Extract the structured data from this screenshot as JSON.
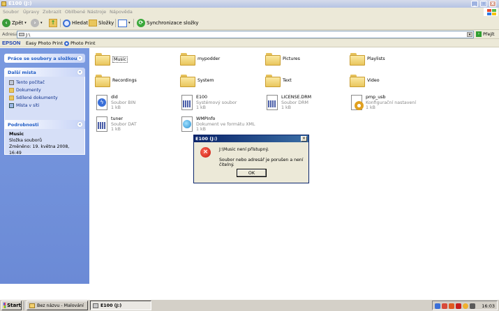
{
  "window": {
    "title": "E100 (J:)",
    "colors": {
      "title_inactive": "#b5c3e3",
      "panel": "#6b8ad6",
      "link": "#0c2f8a"
    }
  },
  "menu": [
    "Soubor",
    "Úpravy",
    "Zobrazit",
    "Oblíbené",
    "Nástroje",
    "Nápověda"
  ],
  "toolbar": {
    "back": "Zpět",
    "search": "Hledat",
    "folders": "Složky",
    "sync": "Synchronizace složky"
  },
  "address": {
    "label": "Adresa",
    "value": "J:\\",
    "go": "Přejít"
  },
  "epson": {
    "brand": "EPSON",
    "easy_photo_print": "Easy Photo Print",
    "photo_print": "Photo Print"
  },
  "left": {
    "tasks_title": "Práce se soubory a složkou",
    "places_title": "Další místa",
    "places": [
      "Tento počítač",
      "Dokumenty",
      "Sdílené dokumenty",
      "Místa v síti"
    ],
    "details_title": "Podrobnosti",
    "details_name": "Music",
    "details_type": "Složka souborů",
    "details_modified": "Změněno: 19. května 2008, 16:49"
  },
  "folders": [
    "Music",
    "mypodder",
    "Pictures",
    "Playlists",
    "Recordings",
    "System",
    "Text",
    "Video"
  ],
  "files": [
    {
      "name": "did",
      "type": "Soubor BIN",
      "size": "1 kB"
    },
    {
      "name": "E100",
      "type": "Systémový soubor",
      "size": "1 kB"
    },
    {
      "name": "LICENSE.DRM",
      "type": "Soubor DRM",
      "size": "1 kB"
    },
    {
      "name": "pmp_usb",
      "type": "Konfigurační nastavení",
      "size": "1 kB"
    },
    {
      "name": "tuner",
      "type": "Soubor DAT",
      "size": "1 kB"
    },
    {
      "name": "WMPInfo",
      "type": "Dokument ve formátu XML",
      "size": "1 kB"
    }
  ],
  "dialog": {
    "title": "E100 (J:)",
    "line1": "J:\\Music není přístupný.",
    "line2": "Soubor nebo adresář je porušen a není čitelný.",
    "ok": "OK"
  },
  "taskbar": {
    "start": "Start",
    "items": [
      "Bez názvu - Malování",
      "E100 (J:)"
    ],
    "clock": "16:03"
  }
}
